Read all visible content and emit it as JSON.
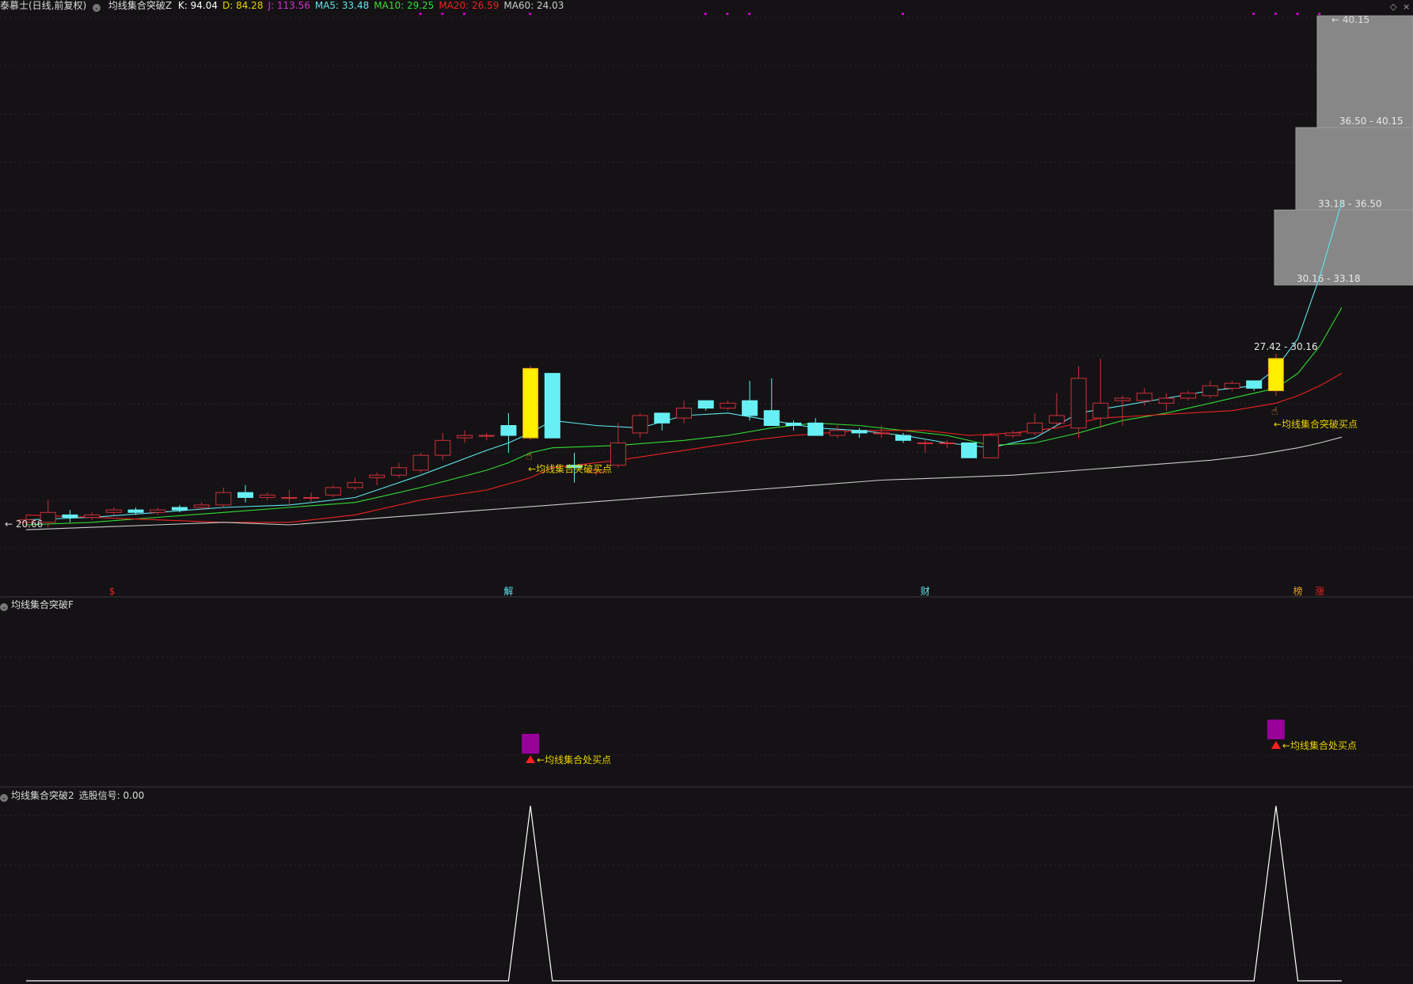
{
  "header": {
    "stock_label": "泰慕士(日线,前复权)",
    "indicator_name": "均线集合突破Z",
    "values": [
      {
        "label": "K: 94.04",
        "color": "#ffffff"
      },
      {
        "label": "D: 84.28",
        "color": "#e8d200"
      },
      {
        "label": "J: 113.56",
        "color": "#cc33cc"
      },
      {
        "label": "MA5: 33.48",
        "color": "#5ee6ee"
      },
      {
        "label": "MA10: 29.25",
        "color": "#33dd33"
      },
      {
        "label": "MA20: 26.59",
        "color": "#ee2222"
      },
      {
        "label": "MA60: 24.03",
        "color": "#cccccc"
      }
    ]
  },
  "pane2": {
    "title": "均线集合突破F",
    "signal_text": "←均线集合处买点"
  },
  "pane3": {
    "title": "均线集合突破2",
    "value_label": "选股信号: 0.00"
  },
  "colors": {
    "background": "#141214",
    "up_candle": "#d0303a",
    "down_candle": "#66f0f5",
    "signal_candle": "#ffee00",
    "ma5": "#5ee6ee",
    "ma10": "#33dd33",
    "ma20": "#ee2222",
    "ma60": "#cccccc",
    "annotation_text": "#e8d200",
    "signal_bar": "#990099",
    "marker_dot": "#cc00cc",
    "zone_fill": "#878787"
  },
  "chart_data": [
    {
      "type": "candlestick",
      "title": "",
      "xlabel": "",
      "ylabel": "",
      "ylim": [
        19.0,
        41.0
      ],
      "grid": true,
      "price_labels": {
        "low": "20.66",
        "high": "40.15"
      },
      "candles": [
        {
          "i": 0,
          "o": 20.6,
          "c": 20.7,
          "h": 20.9,
          "l": 20.4
        },
        {
          "i": 1,
          "o": 20.6,
          "c": 21.0,
          "h": 21.5,
          "l": 20.4
        },
        {
          "i": 2,
          "o": 20.9,
          "c": 20.8,
          "h": 21.1,
          "l": 20.6
        },
        {
          "i": 3,
          "o": 20.8,
          "c": 20.9,
          "h": 21.0,
          "l": 20.7
        },
        {
          "i": 4,
          "o": 21.0,
          "c": 21.1,
          "h": 21.2,
          "l": 20.9
        },
        {
          "i": 5,
          "o": 21.1,
          "c": 21.0,
          "h": 21.2,
          "l": 20.9
        },
        {
          "i": 6,
          "o": 21.0,
          "c": 21.1,
          "h": 21.2,
          "l": 20.9
        },
        {
          "i": 7,
          "o": 21.2,
          "c": 21.1,
          "h": 21.3,
          "l": 21.0
        },
        {
          "i": 8,
          "o": 21.2,
          "c": 21.3,
          "h": 21.4,
          "l": 21.1
        },
        {
          "i": 9,
          "o": 21.3,
          "c": 21.8,
          "h": 22.0,
          "l": 21.2
        },
        {
          "i": 10,
          "o": 21.8,
          "c": 21.6,
          "h": 22.1,
          "l": 21.4
        },
        {
          "i": 11,
          "o": 21.6,
          "c": 21.7,
          "h": 21.8,
          "l": 21.5
        },
        {
          "i": 12,
          "o": 21.6,
          "c": 21.6,
          "h": 21.9,
          "l": 21.3
        },
        {
          "i": 13,
          "o": 21.6,
          "c": 21.6,
          "h": 21.8,
          "l": 21.4
        },
        {
          "i": 14,
          "o": 21.7,
          "c": 22.0,
          "h": 22.1,
          "l": 21.6
        },
        {
          "i": 15,
          "o": 22.0,
          "c": 22.2,
          "h": 22.4,
          "l": 21.9
        },
        {
          "i": 16,
          "o": 22.4,
          "c": 22.5,
          "h": 22.6,
          "l": 22.1
        },
        {
          "i": 17,
          "o": 22.5,
          "c": 22.8,
          "h": 23.0,
          "l": 22.4
        },
        {
          "i": 18,
          "o": 22.7,
          "c": 23.3,
          "h": 23.4,
          "l": 22.6
        },
        {
          "i": 19,
          "o": 23.3,
          "c": 23.9,
          "h": 24.2,
          "l": 23.1
        },
        {
          "i": 20,
          "o": 24.0,
          "c": 24.1,
          "h": 24.3,
          "l": 23.8
        },
        {
          "i": 21,
          "o": 24.1,
          "c": 24.1,
          "h": 24.2,
          "l": 23.9
        },
        {
          "i": 22,
          "o": 24.5,
          "c": 24.1,
          "h": 25.0,
          "l": 23.4
        },
        {
          "i": 23,
          "o": 24.0,
          "c": 26.8,
          "h": 26.9,
          "l": 23.9,
          "signal": true
        },
        {
          "i": 24,
          "o": 26.6,
          "c": 24.0,
          "h": 26.6,
          "l": 24.0
        },
        {
          "i": 25,
          "o": 22.9,
          "c": 22.8,
          "h": 23.4,
          "l": 22.2
        },
        {
          "i": 26,
          "o": 22.6,
          "c": 22.7,
          "h": 22.8,
          "l": 22.5
        },
        {
          "i": 27,
          "o": 22.9,
          "c": 23.8,
          "h": 24.6,
          "l": 22.8
        },
        {
          "i": 28,
          "o": 24.2,
          "c": 24.9,
          "h": 25.0,
          "l": 24.0
        },
        {
          "i": 29,
          "o": 25.0,
          "c": 24.6,
          "h": 25.0,
          "l": 24.3
        },
        {
          "i": 30,
          "o": 24.8,
          "c": 25.2,
          "h": 25.5,
          "l": 24.6
        },
        {
          "i": 31,
          "o": 25.5,
          "c": 25.2,
          "h": 25.5,
          "l": 25.1
        },
        {
          "i": 32,
          "o": 25.2,
          "c": 25.4,
          "h": 25.5,
          "l": 25.1
        },
        {
          "i": 33,
          "o": 25.5,
          "c": 24.9,
          "h": 26.3,
          "l": 24.7
        },
        {
          "i": 34,
          "o": 25.1,
          "c": 24.5,
          "h": 26.4,
          "l": 24.5
        },
        {
          "i": 35,
          "o": 24.6,
          "c": 24.5,
          "h": 24.7,
          "l": 24.3
        },
        {
          "i": 36,
          "o": 24.6,
          "c": 24.1,
          "h": 24.8,
          "l": 24.1
        },
        {
          "i": 37,
          "o": 24.1,
          "c": 24.3,
          "h": 24.5,
          "l": 24.0
        },
        {
          "i": 38,
          "o": 24.3,
          "c": 24.2,
          "h": 24.4,
          "l": 24.0
        },
        {
          "i": 39,
          "o": 24.2,
          "c": 24.2,
          "h": 24.5,
          "l": 24.0
        },
        {
          "i": 40,
          "o": 24.1,
          "c": 23.9,
          "h": 24.2,
          "l": 23.8
        },
        {
          "i": 41,
          "o": 23.8,
          "c": 23.8,
          "h": 23.9,
          "l": 23.4
        },
        {
          "i": 42,
          "o": 23.8,
          "c": 23.8,
          "h": 23.9,
          "l": 23.6
        },
        {
          "i": 43,
          "o": 23.8,
          "c": 23.2,
          "h": 23.8,
          "l": 23.2
        },
        {
          "i": 44,
          "o": 23.2,
          "c": 24.1,
          "h": 24.2,
          "l": 23.2
        },
        {
          "i": 45,
          "o": 24.1,
          "c": 24.2,
          "h": 24.3,
          "l": 24.0
        },
        {
          "i": 46,
          "o": 24.2,
          "c": 24.6,
          "h": 25.0,
          "l": 24.1
        },
        {
          "i": 47,
          "o": 24.6,
          "c": 24.9,
          "h": 25.8,
          "l": 24.5
        },
        {
          "i": 48,
          "o": 24.4,
          "c": 26.4,
          "h": 26.9,
          "l": 24.0
        },
        {
          "i": 49,
          "o": 24.8,
          "c": 25.4,
          "h": 27.2,
          "l": 24.4
        },
        {
          "i": 50,
          "o": 25.5,
          "c": 25.6,
          "h": 25.7,
          "l": 24.5
        },
        {
          "i": 51,
          "o": 25.5,
          "c": 25.8,
          "h": 26.0,
          "l": 25.3
        },
        {
          "i": 52,
          "o": 25.4,
          "c": 25.6,
          "h": 25.8,
          "l": 25.1
        },
        {
          "i": 53,
          "o": 25.6,
          "c": 25.8,
          "h": 25.9,
          "l": 25.5
        },
        {
          "i": 54,
          "o": 25.7,
          "c": 26.1,
          "h": 26.3,
          "l": 25.6
        },
        {
          "i": 55,
          "o": 26.0,
          "c": 26.2,
          "h": 26.3,
          "l": 25.9
        },
        {
          "i": 56,
          "o": 26.3,
          "c": 26.0,
          "h": 26.3,
          "l": 25.9
        },
        {
          "i": 57,
          "o": 25.9,
          "c": 27.2,
          "h": 27.4,
          "l": 25.7,
          "signal": true
        }
      ],
      "ma_lines": [
        {
          "id": "ma5",
          "values": [
            [
              0,
              20.7
            ],
            [
              3,
              20.8
            ],
            [
              6,
              21.0
            ],
            [
              9,
              21.2
            ],
            [
              12,
              21.3
            ],
            [
              15,
              21.6
            ],
            [
              18,
              22.5
            ],
            [
              21,
              23.5
            ],
            [
              22,
              23.8
            ],
            [
              23,
              24.2
            ],
            [
              24,
              24.7
            ],
            [
              26,
              24.5
            ],
            [
              28,
              24.4
            ],
            [
              30,
              24.9
            ],
            [
              32,
              25.0
            ],
            [
              34,
              24.7
            ],
            [
              36,
              24.4
            ],
            [
              38,
              24.3
            ],
            [
              40,
              24.1
            ],
            [
              42,
              23.8
            ],
            [
              44,
              23.6
            ],
            [
              46,
              24.0
            ],
            [
              47,
              24.5
            ],
            [
              48,
              25.0
            ],
            [
              50,
              25.3
            ],
            [
              52,
              25.6
            ],
            [
              54,
              25.9
            ],
            [
              56,
              26.1
            ],
            [
              57,
              26.8
            ],
            [
              58,
              28.0
            ],
            [
              59,
              30.5
            ],
            [
              60,
              33.5
            ]
          ]
        },
        {
          "id": "ma10",
          "values": [
            [
              0,
              20.5
            ],
            [
              3,
              20.6
            ],
            [
              6,
              20.8
            ],
            [
              9,
              21.0
            ],
            [
              12,
              21.2
            ],
            [
              15,
              21.4
            ],
            [
              18,
              22.0
            ],
            [
              21,
              22.7
            ],
            [
              22,
              23.0
            ],
            [
              23,
              23.4
            ],
            [
              24,
              23.6
            ],
            [
              27,
              23.7
            ],
            [
              30,
              23.9
            ],
            [
              32,
              24.1
            ],
            [
              34,
              24.4
            ],
            [
              36,
              24.6
            ],
            [
              38,
              24.5
            ],
            [
              40,
              24.3
            ],
            [
              42,
              24.1
            ],
            [
              44,
              23.7
            ],
            [
              46,
              23.8
            ],
            [
              48,
              24.2
            ],
            [
              50,
              24.7
            ],
            [
              52,
              25.0
            ],
            [
              54,
              25.4
            ],
            [
              56,
              25.8
            ],
            [
              57,
              26.0
            ],
            [
              58,
              26.6
            ],
            [
              59,
              27.7
            ],
            [
              60,
              29.25
            ]
          ]
        },
        {
          "id": "ma20",
          "values": [
            [
              0,
              20.9
            ],
            [
              3,
              20.8
            ],
            [
              6,
              20.7
            ],
            [
              9,
              20.6
            ],
            [
              12,
              20.6
            ],
            [
              15,
              20.9
            ],
            [
              18,
              21.5
            ],
            [
              21,
              21.9
            ],
            [
              23,
              22.4
            ],
            [
              24,
              22.8
            ],
            [
              27,
              23.1
            ],
            [
              30,
              23.5
            ],
            [
              33,
              23.9
            ],
            [
              35,
              24.1
            ],
            [
              38,
              24.3
            ],
            [
              41,
              24.3
            ],
            [
              43,
              24.1
            ],
            [
              45,
              24.2
            ],
            [
              47,
              24.4
            ],
            [
              49,
              24.8
            ],
            [
              51,
              24.9
            ],
            [
              53,
              25.0
            ],
            [
              55,
              25.1
            ],
            [
              57,
              25.4
            ],
            [
              58,
              25.7
            ],
            [
              59,
              26.1
            ],
            [
              60,
              26.6
            ]
          ]
        },
        {
          "id": "ma60",
          "values": [
            [
              0,
              20.3
            ],
            [
              3,
              20.4
            ],
            [
              6,
              20.5
            ],
            [
              9,
              20.6
            ],
            [
              12,
              20.5
            ],
            [
              15,
              20.7
            ],
            [
              18,
              20.9
            ],
            [
              21,
              21.1
            ],
            [
              24,
              21.3
            ],
            [
              27,
              21.5
            ],
            [
              30,
              21.7
            ],
            [
              33,
              21.9
            ],
            [
              36,
              22.1
            ],
            [
              39,
              22.3
            ],
            [
              42,
              22.4
            ],
            [
              45,
              22.5
            ],
            [
              48,
              22.7
            ],
            [
              51,
              22.9
            ],
            [
              54,
              23.1
            ],
            [
              56,
              23.3
            ],
            [
              58,
              23.6
            ],
            [
              59,
              23.8
            ],
            [
              60,
              24.03
            ]
          ]
        }
      ],
      "price_zones": [
        {
          "label": "27.42 - 30.16",
          "low": 27.42,
          "high": 30.16
        },
        {
          "label": "30.16 - 33.18",
          "low": 30.16,
          "high": 33.18
        },
        {
          "label": "33.18 - 36.50",
          "low": 33.18,
          "high": 36.5
        },
        {
          "label": "36.50 - 40.15",
          "low": 36.5,
          "high": 40.15
        }
      ],
      "annotations": [
        {
          "i": 23,
          "text": "←均线集合突破买点"
        },
        {
          "i": 57,
          "text": "←均线集合突破买点"
        }
      ],
      "top_markers": [
        18,
        19,
        20,
        23,
        31,
        32,
        33,
        40,
        56,
        57,
        58,
        59
      ],
      "event_tags": [
        {
          "i": 4,
          "text": "$",
          "color": "#ee2222"
        },
        {
          "i": 22,
          "text": "解",
          "color": "#5ee6ee"
        },
        {
          "i": 41,
          "text": "财",
          "color": "#5ee6ee"
        },
        {
          "i": 58,
          "text": "榜",
          "color": "#e8a020"
        },
        {
          "i": 59,
          "text": "涨",
          "color": "#ee2222"
        }
      ]
    },
    {
      "type": "bar",
      "title": "",
      "signals": [
        {
          "i": 23,
          "value": 1,
          "text": "←均线集合处买点"
        },
        {
          "i": 57,
          "value": 1,
          "text": "←均线集合处买点"
        }
      ]
    },
    {
      "type": "line",
      "title": "",
      "ylim": [
        0,
        1
      ],
      "series": [
        {
          "values": [
            [
              0,
              0
            ],
            [
              22,
              0
            ],
            [
              23,
              1
            ],
            [
              24,
              0
            ],
            [
              56,
              0
            ],
            [
              57,
              1
            ],
            [
              58,
              0
            ],
            [
              60,
              0
            ]
          ]
        }
      ]
    }
  ]
}
